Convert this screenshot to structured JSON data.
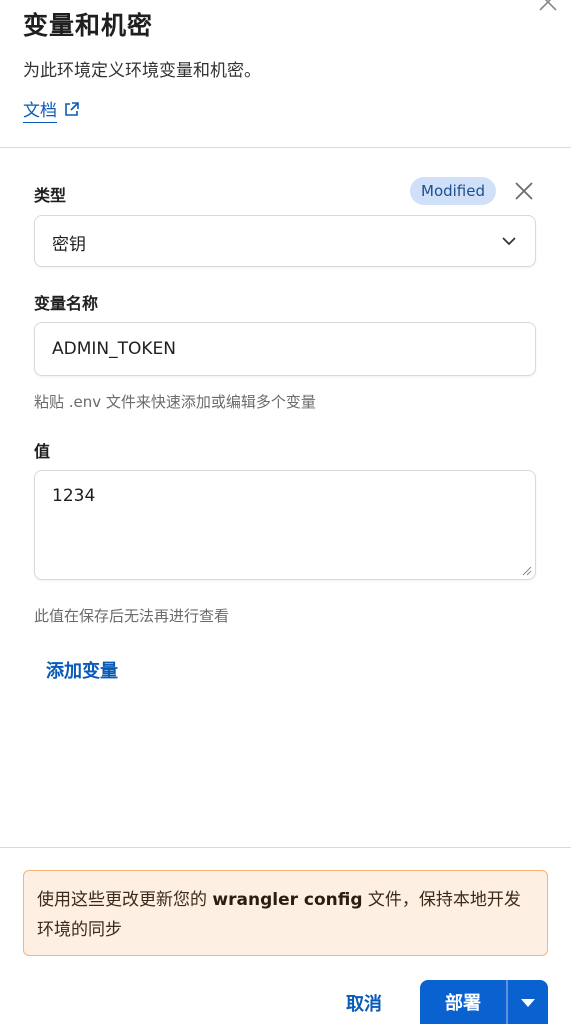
{
  "header": {
    "title": "变量和机密",
    "subtitle": "为此环境定义环境变量和机密。",
    "docs_label": "文档"
  },
  "form": {
    "type_label": "类型",
    "badge": "Modified",
    "type_value": "密钥",
    "name_label": "变量名称",
    "name_value": "ADMIN_TOKEN",
    "name_help": "粘贴 .env 文件来快速添加或编辑多个变量",
    "value_label": "值",
    "value_value": "1234",
    "value_help": "此值在保存后无法再进行查看",
    "add_variable": "添加变量"
  },
  "notice": {
    "text_before": "使用这些更改更新您的 ",
    "code": "wrangler config",
    "text_after": " 文件，保持本地开发环境的同步"
  },
  "footer": {
    "cancel": "取消",
    "deploy": "部署"
  },
  "colors": {
    "accent": "#0a62d0",
    "link": "#0a5bb8",
    "badge_bg": "#cfe0f8",
    "warning_bg": "#fdf0e3",
    "warning_border": "#f3b57a"
  },
  "icons": {
    "close": "close-icon",
    "external_link": "external-link-icon",
    "chevron": "chevron-down-icon",
    "caret": "caret-down-icon"
  }
}
